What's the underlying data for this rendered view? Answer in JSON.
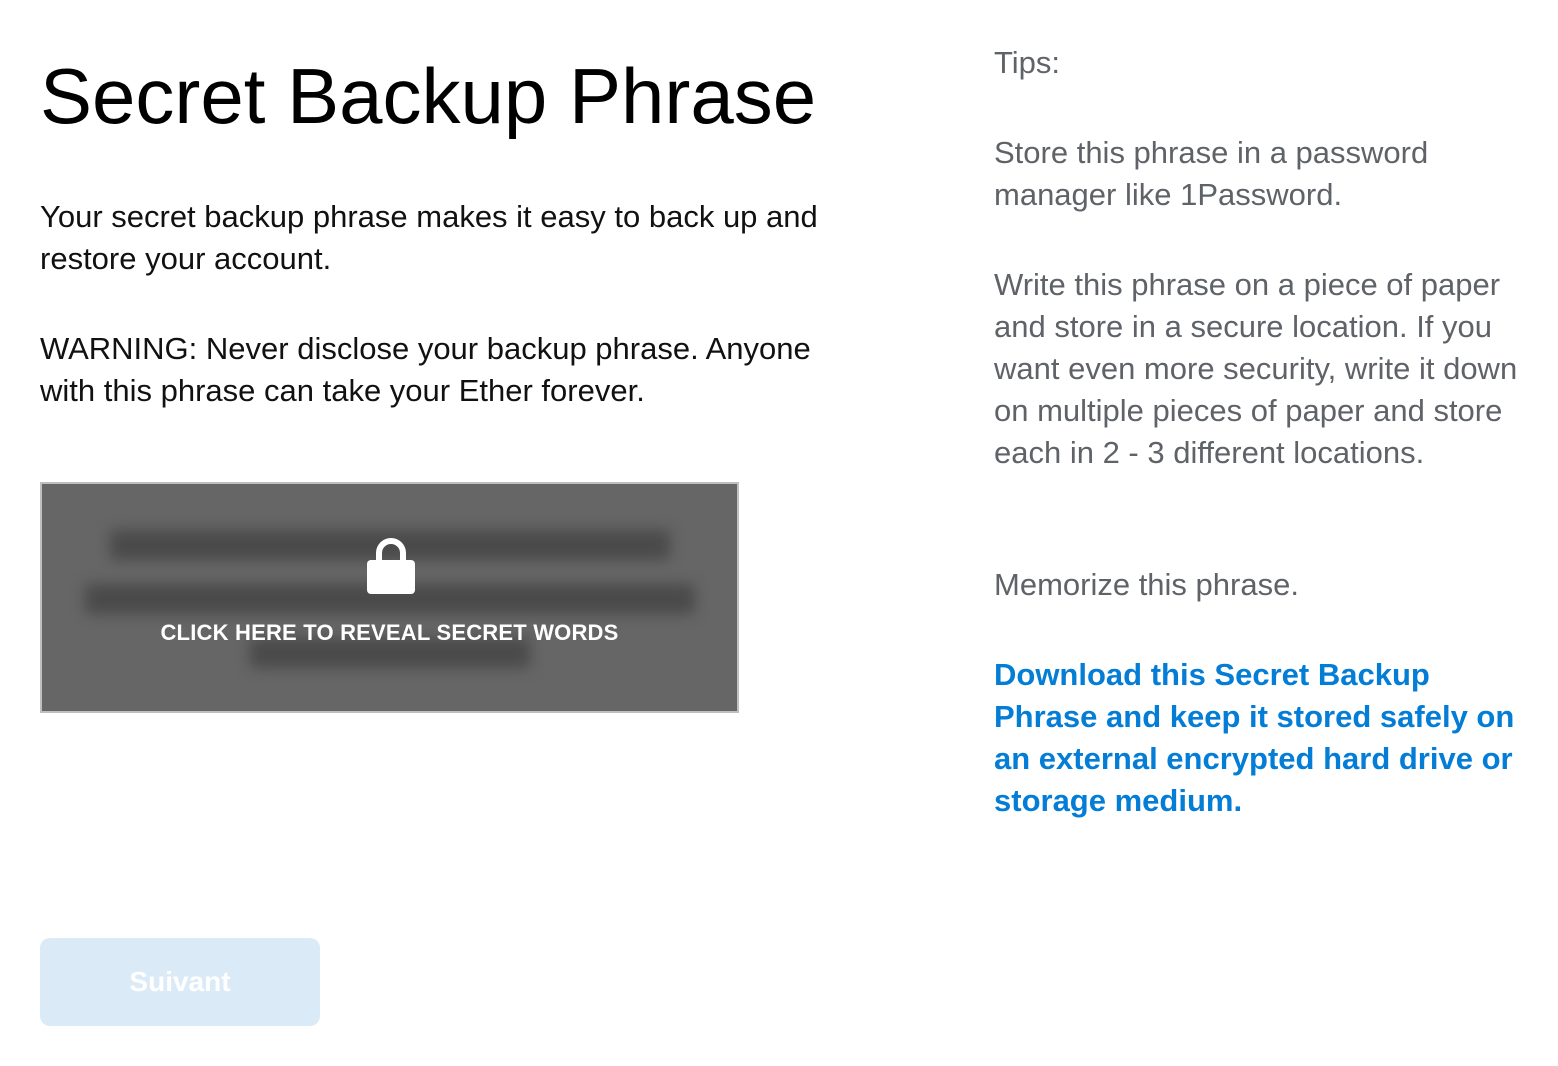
{
  "header": {
    "title": "Secret Backup Phrase"
  },
  "intro": {
    "description": "Your secret backup phrase makes it easy to back up and restore your account.",
    "warning": "WARNING: Never disclose your backup phrase. Anyone with this phrase can take your Ether forever."
  },
  "reveal": {
    "label": "CLICK HERE TO REVEAL SECRET WORDS",
    "icon": "lock-icon"
  },
  "actions": {
    "next_label": "Suivant"
  },
  "tips": {
    "title": "Tips:",
    "items": [
      "Store this phrase in a password manager like 1Password.",
      "Write this phrase on a piece of paper and store in a secure location. If you want even more security, write it down on multiple pieces of paper and store each in 2 - 3 different locations.",
      "Memorize this phrase."
    ],
    "download_link": "Download this Secret Backup Phrase and keep it stored safely on an external encrypted hard drive or storage medium."
  },
  "colors": {
    "link": "#037dd6",
    "reveal_bg": "#666666",
    "button_disabled_bg": "#dbeaf7",
    "tips_text": "#5f6368"
  }
}
